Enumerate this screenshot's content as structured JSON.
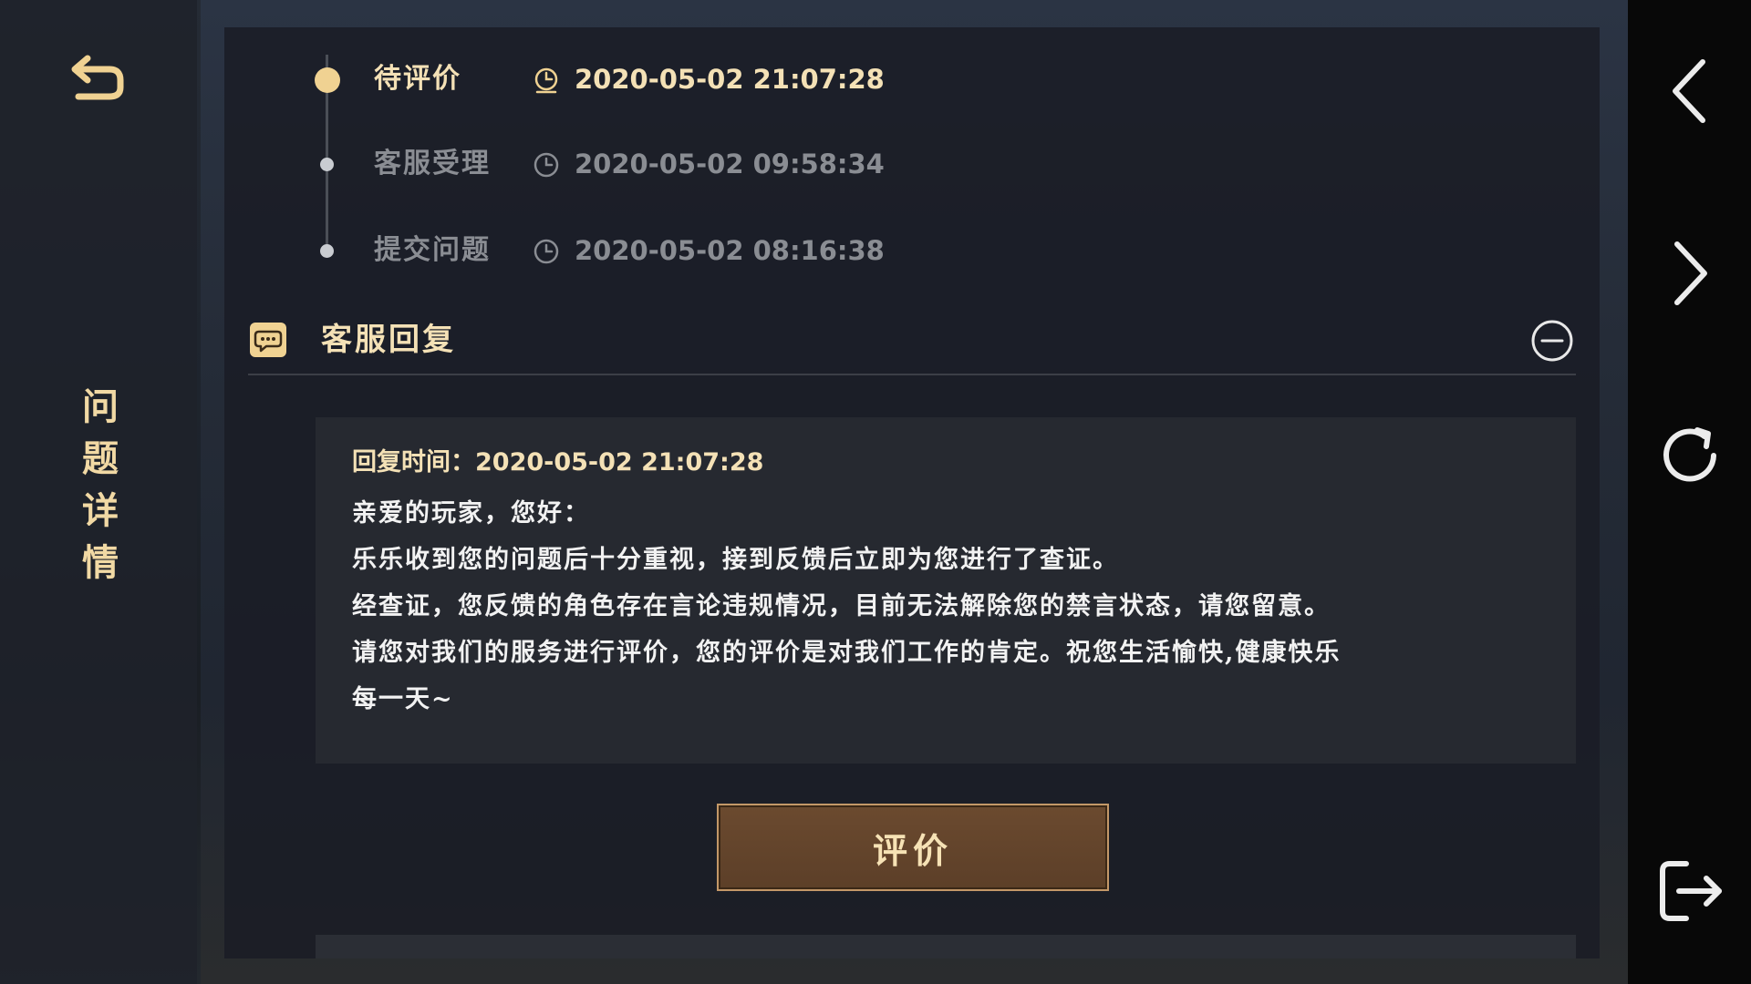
{
  "sidebar": {
    "title_chars": [
      "问",
      "题",
      "详",
      "情"
    ]
  },
  "timeline": [
    {
      "label": "待评价",
      "time": "2020-05-02 21:07:28",
      "state": "active"
    },
    {
      "label": "客服受理",
      "time": "2020-05-02 09:58:34",
      "state": "inactive"
    },
    {
      "label": "提交问题",
      "time": "2020-05-02 08:16:38",
      "state": "inactive"
    }
  ],
  "reply_section": {
    "title": "客服回复",
    "reply_time_label": "回复时间：2020-05-02 21:07:28",
    "body_lines": [
      "亲爱的玩家，您好：",
      "乐乐收到您的问题后十分重视，接到反馈后立即为您进行了查证。",
      "经查证，您反馈的角色存在言论违规情况，目前无法解除您的禁言状态，请您留意。",
      "请您对我们的服务进行评价，您的评价是对我们工作的肯定。祝您生活愉快,健康快乐",
      "每一天~"
    ]
  },
  "actions": {
    "rate_label": "评价"
  },
  "icons": {
    "back": "back-arrow-icon",
    "prev": "chevron-left-icon",
    "next": "chevron-right-icon",
    "refresh": "refresh-icon",
    "exit": "exit-icon",
    "clock": "clock-icon",
    "chat": "chat-bubble-icon",
    "collapse": "minus-circle-icon"
  },
  "colors": {
    "accent_gold": "#f0d292",
    "text_gold": "#f4e1b6",
    "muted_gray": "#8a8d93",
    "button_brown": "#5c3f28"
  }
}
